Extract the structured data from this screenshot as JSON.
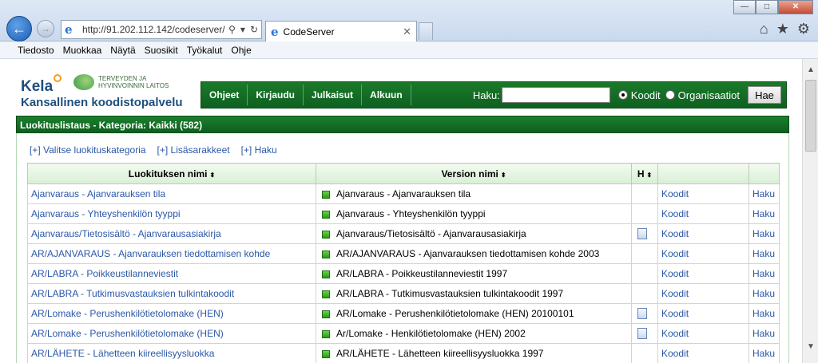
{
  "browser": {
    "url": "http://91.202.112.142/codeserver/",
    "tab_title": "CodeServer",
    "menu": [
      "Tiedosto",
      "Muokkaa",
      "Näytä",
      "Suosikit",
      "Työkalut",
      "Ohje"
    ]
  },
  "site": {
    "brand": "Kela",
    "partner": "TERVEYDEN JA HYVINVOINNIN LAITOS",
    "subtitle": "Kansallinen koodistopalvelu",
    "nav": [
      "Ohjeet",
      "Kirjaudu",
      "Julkaisut",
      "Alkuun"
    ],
    "search": {
      "label": "Haku:",
      "value": "",
      "option_codes": "Koodit",
      "option_orgs": "Organisaatiot",
      "selected": "Koodit",
      "button": "Hae"
    }
  },
  "listing": {
    "title": "Luokituslistaus - Kategoria: Kaikki (582)",
    "actions": [
      "[+] Valitse luokituskategoria",
      "[+] Lisäsarakkeet",
      "[+] Haku"
    ],
    "columns": {
      "name": "Luokituksen nimi",
      "version": "Version nimi",
      "h": "H",
      "sort_glyph": "⬍"
    },
    "rows": [
      {
        "name": "Ajanvaraus - Ajanvarauksen tila",
        "version": "Ajanvaraus - Ajanvarauksen tila",
        "doc": false,
        "codes": "Koodit",
        "search": "Haku"
      },
      {
        "name": "Ajanvaraus - Yhteyshenkilön tyyppi",
        "version": "Ajanvaraus - Yhteyshenkilön tyyppi",
        "doc": false,
        "codes": "Koodit",
        "search": "Haku"
      },
      {
        "name": "Ajanvaraus/Tietosisältö - Ajanvarausasiakirja",
        "version": "Ajanvaraus/Tietosisältö - Ajanvarausasiakirja",
        "doc": true,
        "codes": "Koodit",
        "search": "Haku"
      },
      {
        "name": "AR/AJANVARAUS - Ajanvarauksen tiedottamisen kohde",
        "version": "AR/AJANVARAUS - Ajanvarauksen tiedottamisen kohde 2003",
        "doc": false,
        "codes": "Koodit",
        "search": "Haku"
      },
      {
        "name": "AR/LABRA - Poikkeustilanneviestit",
        "version": "AR/LABRA - Poikkeustilanneviestit 1997",
        "doc": false,
        "codes": "Koodit",
        "search": "Haku"
      },
      {
        "name": "AR/LABRA - Tutkimusvastauksien tulkintakoodit",
        "version": "AR/LABRA - Tutkimusvastauksien tulkintakoodit 1997",
        "doc": false,
        "codes": "Koodit",
        "search": "Haku"
      },
      {
        "name": "AR/Lomake - Perushenkilötietolomake (HEN)",
        "version": "AR/Lomake - Perushenkilötietolomake (HEN) 20100101",
        "doc": true,
        "codes": "Koodit",
        "search": "Haku"
      },
      {
        "name": "AR/Lomake - Perushenkilötietolomake (HEN)",
        "version": "Ar/Lomake - Henkilötietolomake (HEN) 2002",
        "doc": true,
        "codes": "Koodit",
        "search": "Haku"
      },
      {
        "name": "AR/LÄHETE - Lähetteen kiireellisyysluokka",
        "version": "AR/LÄHETE - Lähetteen kiireellisyysluokka 1997",
        "doc": false,
        "codes": "Koodit",
        "search": "Haku"
      }
    ]
  }
}
